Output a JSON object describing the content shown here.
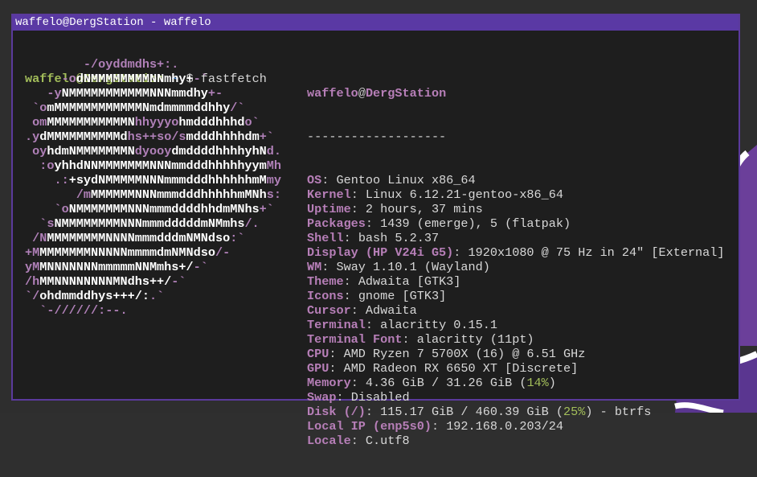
{
  "window": {
    "title": "waffelo@DergStation - waffelo"
  },
  "prompt": {
    "user_host": "waffelo@DergStation",
    "cwd": "~",
    "symbol": "$",
    "command": "fastfetch"
  },
  "logo": [
    [
      [
        "        ",
        "w"
      ],
      [
        "-/oyddmdhs+:.",
        "m"
      ]
    ],
    [
      [
        "     ",
        "w"
      ],
      [
        "-o",
        "m"
      ],
      [
        "dNMMMMMMMMNNmhy+",
        "w"
      ],
      [
        "-`",
        "m"
      ]
    ],
    [
      [
        "   ",
        "w"
      ],
      [
        "-y",
        "m"
      ],
      [
        "NMMMMMMMMMMMNNNmmdhy",
        "w"
      ],
      [
        "+-",
        "m"
      ]
    ],
    [
      [
        " ",
        "w"
      ],
      [
        "`o",
        "m"
      ],
      [
        "mMMMMMMMMMMMMNmdmmmmddhhy",
        "w"
      ],
      [
        "/`",
        "m"
      ]
    ],
    [
      [
        " ",
        "w"
      ],
      [
        "om",
        "m"
      ],
      [
        "MMMMMMMMMMMN",
        "w"
      ],
      [
        "hhyyyo",
        "m"
      ],
      [
        "hmdddhhhd",
        "w"
      ],
      [
        "o`",
        "m"
      ]
    ],
    [
      [
        ".",
        "m"
      ],
      [
        "y",
        "m"
      ],
      [
        "dMMMMMMMMMMd",
        "w"
      ],
      [
        "hs++so/s",
        "m"
      ],
      [
        "mdddhhhhdm",
        "w"
      ],
      [
        "+`",
        "m"
      ]
    ],
    [
      [
        " ",
        "w"
      ],
      [
        "oy",
        "m"
      ],
      [
        "hdmNMMMMMMMN",
        "w"
      ],
      [
        "dyooy",
        "m"
      ],
      [
        "dmddddhhhhyhN",
        "w"
      ],
      [
        "d.",
        "m"
      ]
    ],
    [
      [
        "  ",
        "w"
      ],
      [
        ":o",
        "m"
      ],
      [
        "yhhdNNMMMMMMMNNNmmdddhhhhhyym",
        "w"
      ],
      [
        "Mh",
        "m"
      ]
    ],
    [
      [
        "    ",
        "w"
      ],
      [
        ".:",
        "m"
      ],
      [
        "+sydNMMMMMNNNmmmdddhhhhhhmM",
        "w"
      ],
      [
        "my",
        "m"
      ]
    ],
    [
      [
        "       ",
        "w"
      ],
      [
        "/m",
        "m"
      ],
      [
        "MMMMMMNNNmmmdddhhhhhmMNh",
        "w"
      ],
      [
        "s:",
        "m"
      ]
    ],
    [
      [
        "    ",
        "w"
      ],
      [
        "`o",
        "m"
      ],
      [
        "NMMMMMMMNNNmmmddddhhdmMNhs",
        "w"
      ],
      [
        "+`",
        "m"
      ]
    ],
    [
      [
        "  ",
        "w"
      ],
      [
        "`s",
        "m"
      ],
      [
        "NMMMMMMMMNNNmmmdddddmNMmhs",
        "w"
      ],
      [
        "/.",
        "m"
      ]
    ],
    [
      [
        " ",
        "w"
      ],
      [
        "/N",
        "m"
      ],
      [
        "MMMMMMMMNNNNmmmdddmNMNdso",
        "w"
      ],
      [
        ":`",
        "m"
      ]
    ],
    [
      [
        "+M",
        "m"
      ],
      [
        "MMMMMMMNNNNNmmmmdmNMNdso",
        "w"
      ],
      [
        "/-",
        "m"
      ]
    ],
    [
      [
        "yM",
        "m"
      ],
      [
        "MNNNNNNNmmmmmNNMmhs+/",
        "w"
      ],
      [
        "-`",
        "m"
      ]
    ],
    [
      [
        "/h",
        "m"
      ],
      [
        "MMNNNNNNNNMNdhs++/",
        "w"
      ],
      [
        "-`",
        "m"
      ]
    ],
    [
      [
        "`/",
        "m"
      ],
      [
        "ohdmmddhys+++/:",
        "w"
      ],
      [
        ".`",
        "m"
      ]
    ],
    [
      [
        "  `-//////:--.",
        "m"
      ]
    ]
  ],
  "info": {
    "user": "waffelo",
    "at": "@",
    "host": "DergStation",
    "separator": "-------------------",
    "rows": [
      {
        "key": "OS",
        "value": "Gentoo Linux x86_64"
      },
      {
        "key": "Kernel",
        "value": "Linux 6.12.21-gentoo-x86_64"
      },
      {
        "key": "Uptime",
        "value": "2 hours, 37 mins"
      },
      {
        "key": "Packages",
        "value": "1439 (emerge), 5 (flatpak)"
      },
      {
        "key": "Shell",
        "value": "bash 5.2.37"
      },
      {
        "key": "Display (HP V24i G5)",
        "value": "1920x1080 @ 75 Hz in 24\" [External]"
      },
      {
        "key": "WM",
        "value": "Sway 1.10.1 (Wayland)"
      },
      {
        "key": "Theme",
        "value": "Adwaita [GTK3]"
      },
      {
        "key": "Icons",
        "value": "gnome [GTK3]"
      },
      {
        "key": "Cursor",
        "value": "Adwaita"
      },
      {
        "key": "Terminal",
        "value": "alacritty 0.15.1"
      },
      {
        "key": "Terminal Font",
        "value": "alacritty (11pt)"
      },
      {
        "key": "CPU",
        "value": "AMD Ryzen 7 5700X (16) @ 6.51 GHz"
      },
      {
        "key": "GPU",
        "value": "AMD Radeon RX 6650 XT [Discrete]"
      },
      {
        "key": "Memory",
        "value": "4.36 GiB / 31.26 GiB (",
        "pct": "14%",
        "tail": ")"
      },
      {
        "key": "Swap",
        "value": "Disabled"
      },
      {
        "key": "Disk (/)",
        "value": "115.17 GiB / 460.39 GiB (",
        "pct": "25%",
        "tail": ") - btrfs"
      },
      {
        "key": "Local IP (enp5s0)",
        "value": "192.168.0.203/24"
      },
      {
        "key": "Locale",
        "value": "C.utf8"
      }
    ]
  },
  "colors": {
    "accent": "#5a39a4",
    "key": "#b77fb8",
    "prompt_user": "#a3be5a",
    "prompt_path": "#4f8fd6",
    "percent": "#a3be5a"
  }
}
